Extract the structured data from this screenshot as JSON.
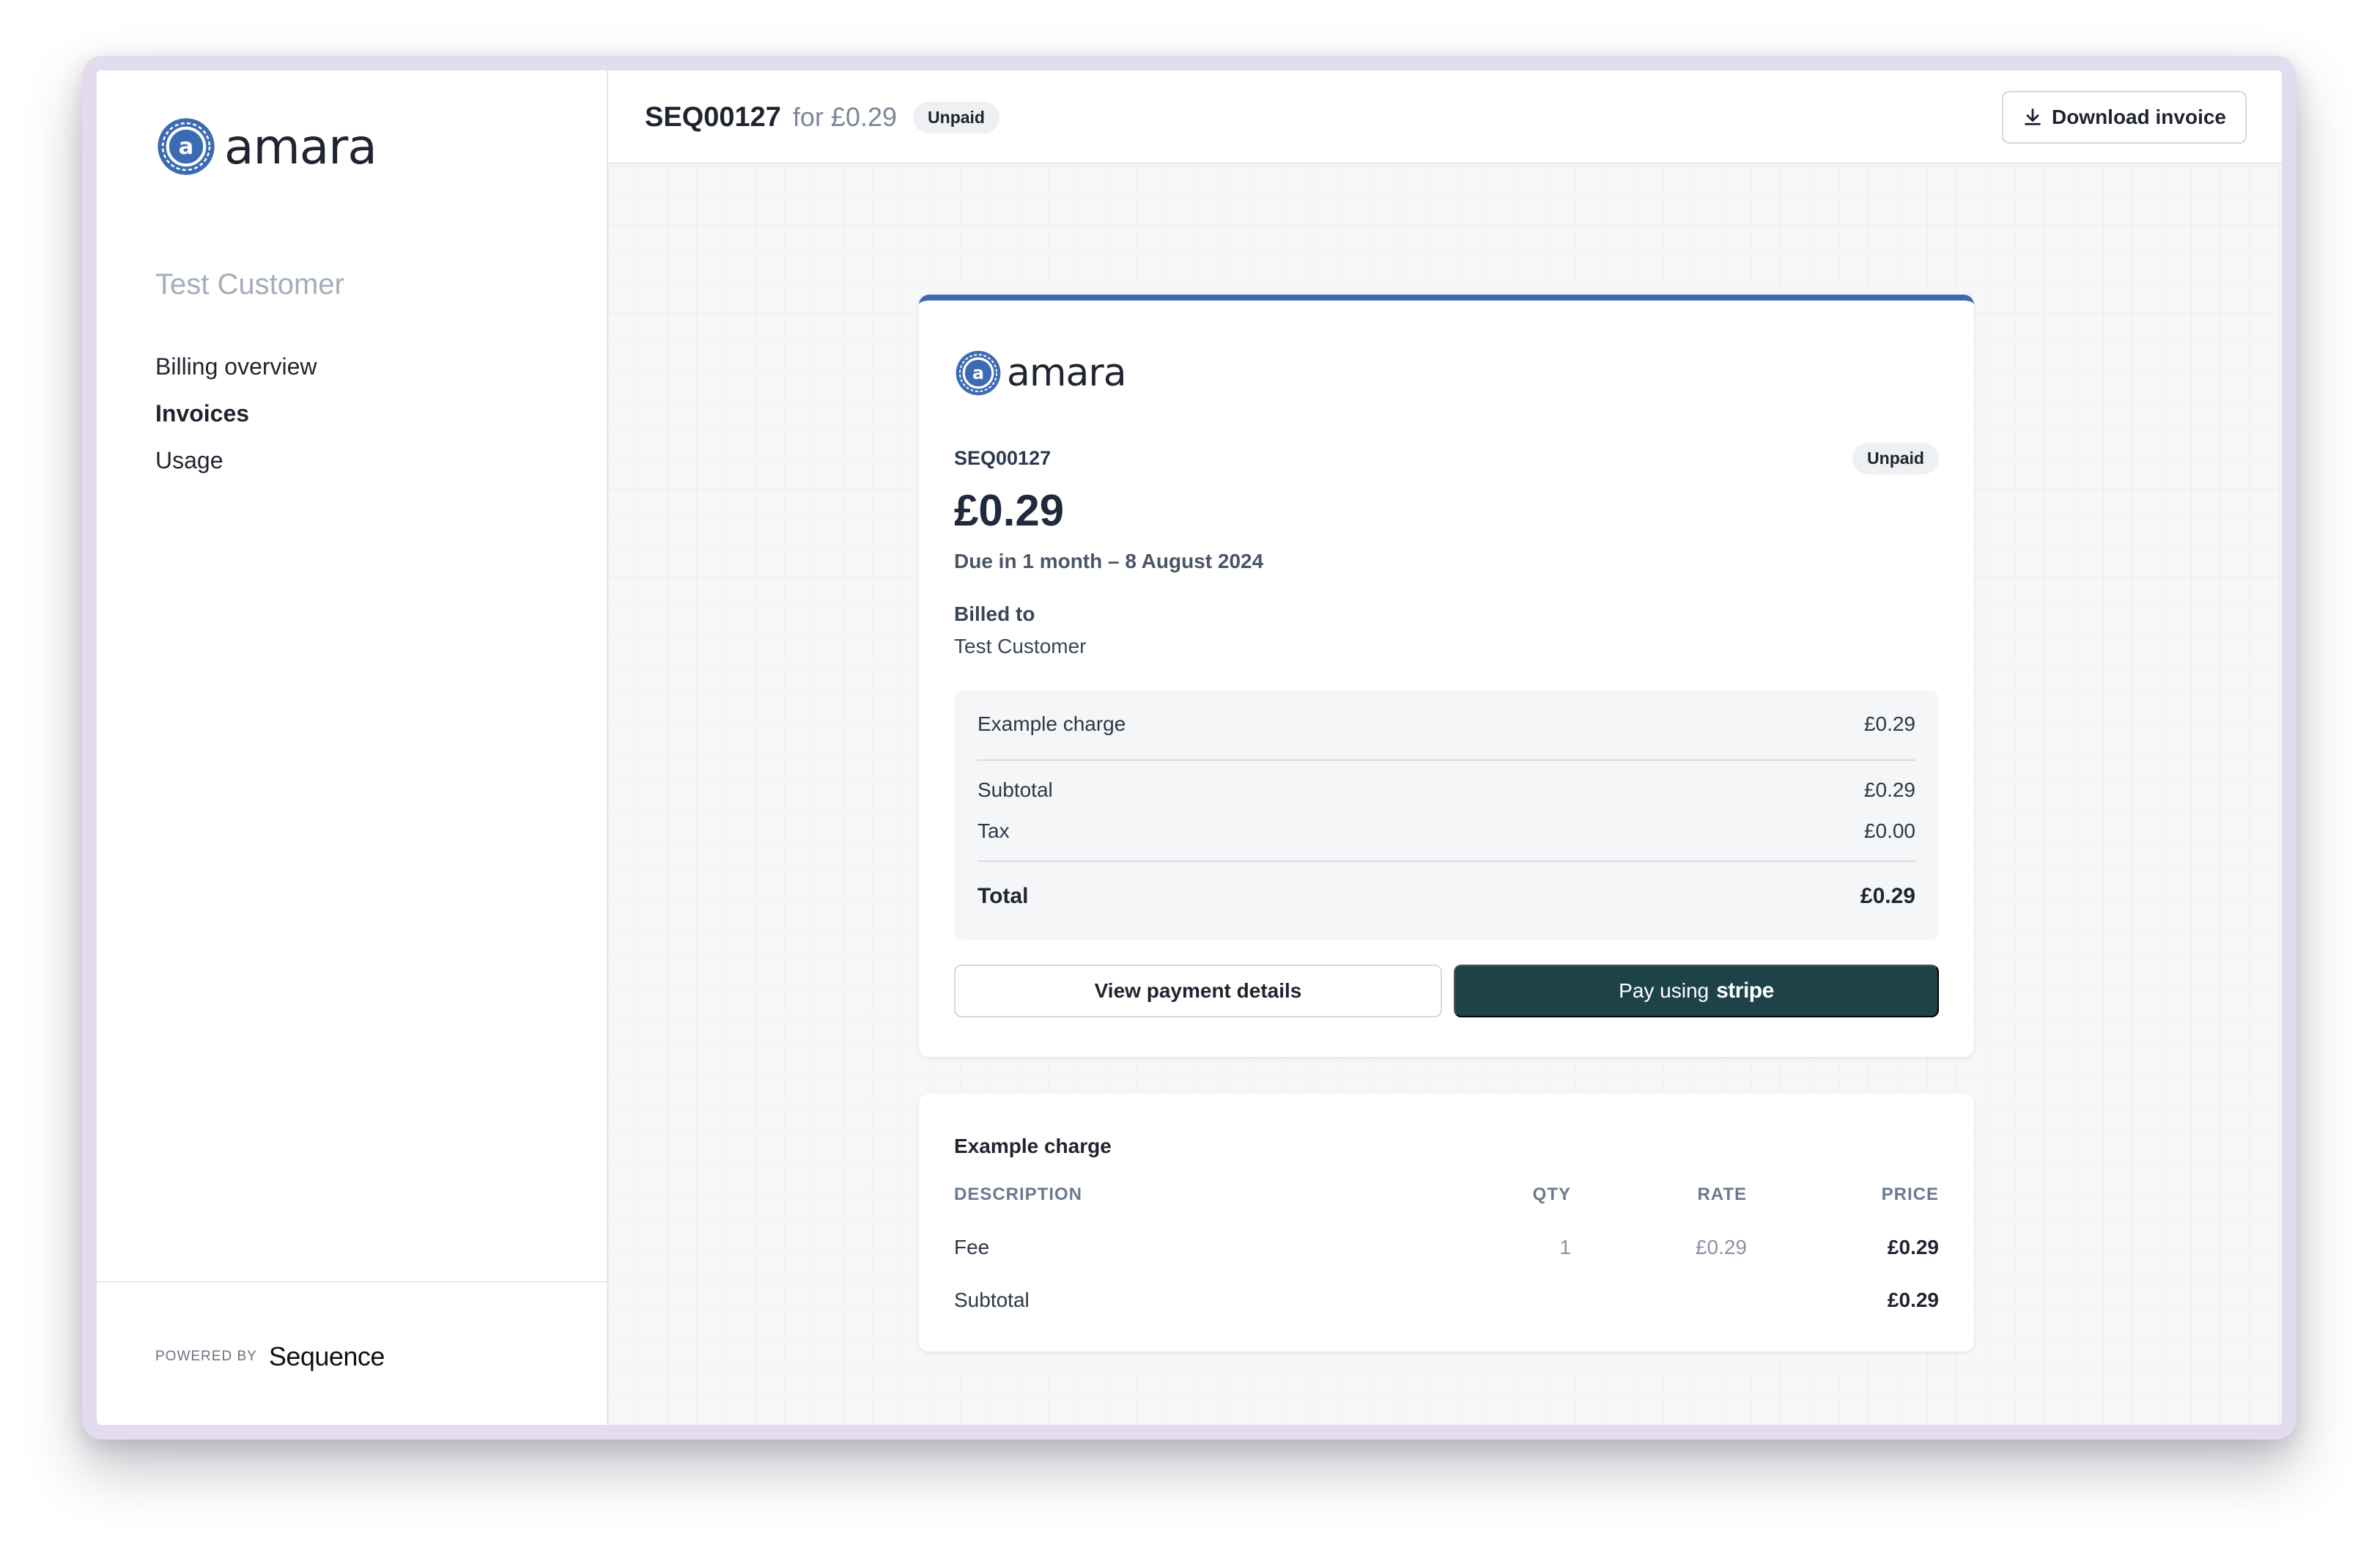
{
  "brand": {
    "name": "amara",
    "accent": "#3b6bb0"
  },
  "sidebar": {
    "customer_name": "Test Customer",
    "nav": [
      {
        "label": "Billing overview",
        "active": false
      },
      {
        "label": "Invoices",
        "active": true
      },
      {
        "label": "Usage",
        "active": false
      }
    ],
    "powered_by_label": "POWERED BY",
    "powered_by_brand": "Sequence"
  },
  "header": {
    "invoice_id": "SEQ00127",
    "for_text": "for £0.29",
    "status": "Unpaid",
    "download_label": "Download invoice",
    "download_icon": "download-icon"
  },
  "invoice": {
    "id": "SEQ00127",
    "status": "Unpaid",
    "amount": "£0.29",
    "due": "Due in 1 month – 8 August 2024",
    "billed_to_label": "Billed to",
    "billed_to_name": "Test Customer",
    "summary": {
      "line_label": "Example charge",
      "line_value": "£0.29",
      "subtotal_label": "Subtotal",
      "subtotal_value": "£0.29",
      "tax_label": "Tax",
      "tax_value": "£0.00",
      "total_label": "Total",
      "total_value": "£0.29"
    },
    "view_button": "View payment details",
    "pay_button_prefix": "Pay using",
    "pay_button_brand": "stripe",
    "pay_button_color": "#1d4349"
  },
  "detail": {
    "title": "Example charge",
    "headers": {
      "description": "DESCRIPTION",
      "qty": "QTY",
      "rate": "RATE",
      "price": "PRICE"
    },
    "rows": [
      {
        "description": "Fee",
        "qty": "1",
        "rate": "£0.29",
        "price": "£0.29"
      }
    ],
    "subtotal_label": "Subtotal",
    "subtotal_value": "£0.29"
  }
}
